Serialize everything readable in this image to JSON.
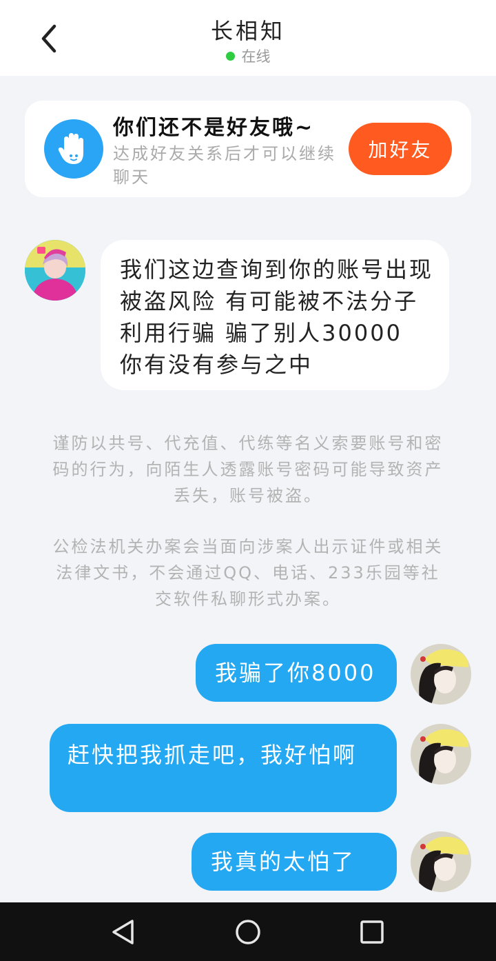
{
  "header": {
    "title": "长相知",
    "status": "在线"
  },
  "friend_card": {
    "title": "你们还不是好友哦~",
    "description": "达成好友关系后才可以继续聊天",
    "add_button": "加好友"
  },
  "messages": [
    {
      "side": "incoming",
      "text": "我们这边查询到你的账号出现被盗风险 有可能被不法分子利用行骗 骗了别人30000 你有没有参与之中"
    },
    {
      "side": "outgoing",
      "text": "我骗了你8000"
    },
    {
      "side": "outgoing",
      "text": "赶快把我抓走吧，我好怕啊"
    },
    {
      "side": "outgoing",
      "text": "我真的太怕了"
    }
  ],
  "notices": [
    "谨防以共号、代充值、代练等名义索要账号和密码的行为，向陌生人透露账号密码可能导致资产丢失，账号被盗。",
    "公检法机关办案会当面向涉案人出示证件或相关法律文书，不会通过QQ、电话、233乐园等社交软件私聊形式办案。"
  ],
  "colors": {
    "accent_blue": "#24a8f2",
    "add_button": "#ff5a1f",
    "online_dot": "#2ecc40",
    "background": "#f3f4f8"
  },
  "icons": {
    "back": "chevron-left-icon",
    "wave_hand": "hand-icon",
    "nav_back": "triangle-back-icon",
    "nav_home": "circle-home-icon",
    "nav_recent": "square-recent-icon"
  }
}
